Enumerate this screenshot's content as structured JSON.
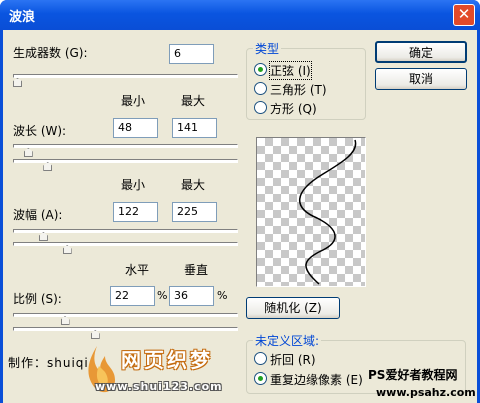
{
  "window": {
    "title": "波浪",
    "close_glyph": "✕"
  },
  "generators": {
    "label": "生成器数 (G):",
    "value": "6"
  },
  "col_headers": {
    "min": "最小",
    "max": "最大",
    "horizontal": "水平",
    "vertical": "垂直",
    "percent": "%"
  },
  "wavelength": {
    "label": "波长 (W):",
    "min": "48",
    "max": "141"
  },
  "amplitude": {
    "label": "波幅 (A):",
    "min": "122",
    "max": "225"
  },
  "scale": {
    "label": "比例 (S):",
    "horizontal": "22",
    "vertical": "36"
  },
  "type_group": {
    "title": "类型",
    "options": [
      {
        "label": "正弦 (I)",
        "selected": true
      },
      {
        "label": "三角形 (T)",
        "selected": false
      },
      {
        "label": "方形 (Q)",
        "selected": false
      }
    ]
  },
  "buttons": {
    "ok": "确定",
    "cancel": "取消",
    "randomize": "随机化 (Z)"
  },
  "undefined_group": {
    "title": "未定义区域:",
    "options": [
      {
        "label": "折回 (R)",
        "selected": false
      },
      {
        "label": "重复边缘像素 (E)",
        "selected": true
      }
    ]
  },
  "watermark": {
    "credit": "制作：shuiqi",
    "logo_text": "网页织梦",
    "logo_url": "www.shui123.com",
    "site_name": "PS爱好者教程网",
    "site_url": "www.psahz.com"
  },
  "slider_levels": {
    "generators": 0.0,
    "wavelength_min": 0.05,
    "wavelength_max": 0.14,
    "amplitude_min": 0.12,
    "amplitude_max": 0.23,
    "scale_h": 0.22,
    "scale_v": 0.36
  },
  "colors": {
    "titlebar": "#0a4fd8",
    "dialog_bg": "#ece9d8",
    "group_title": "#0046d5",
    "radio_dot": "#21a121"
  }
}
